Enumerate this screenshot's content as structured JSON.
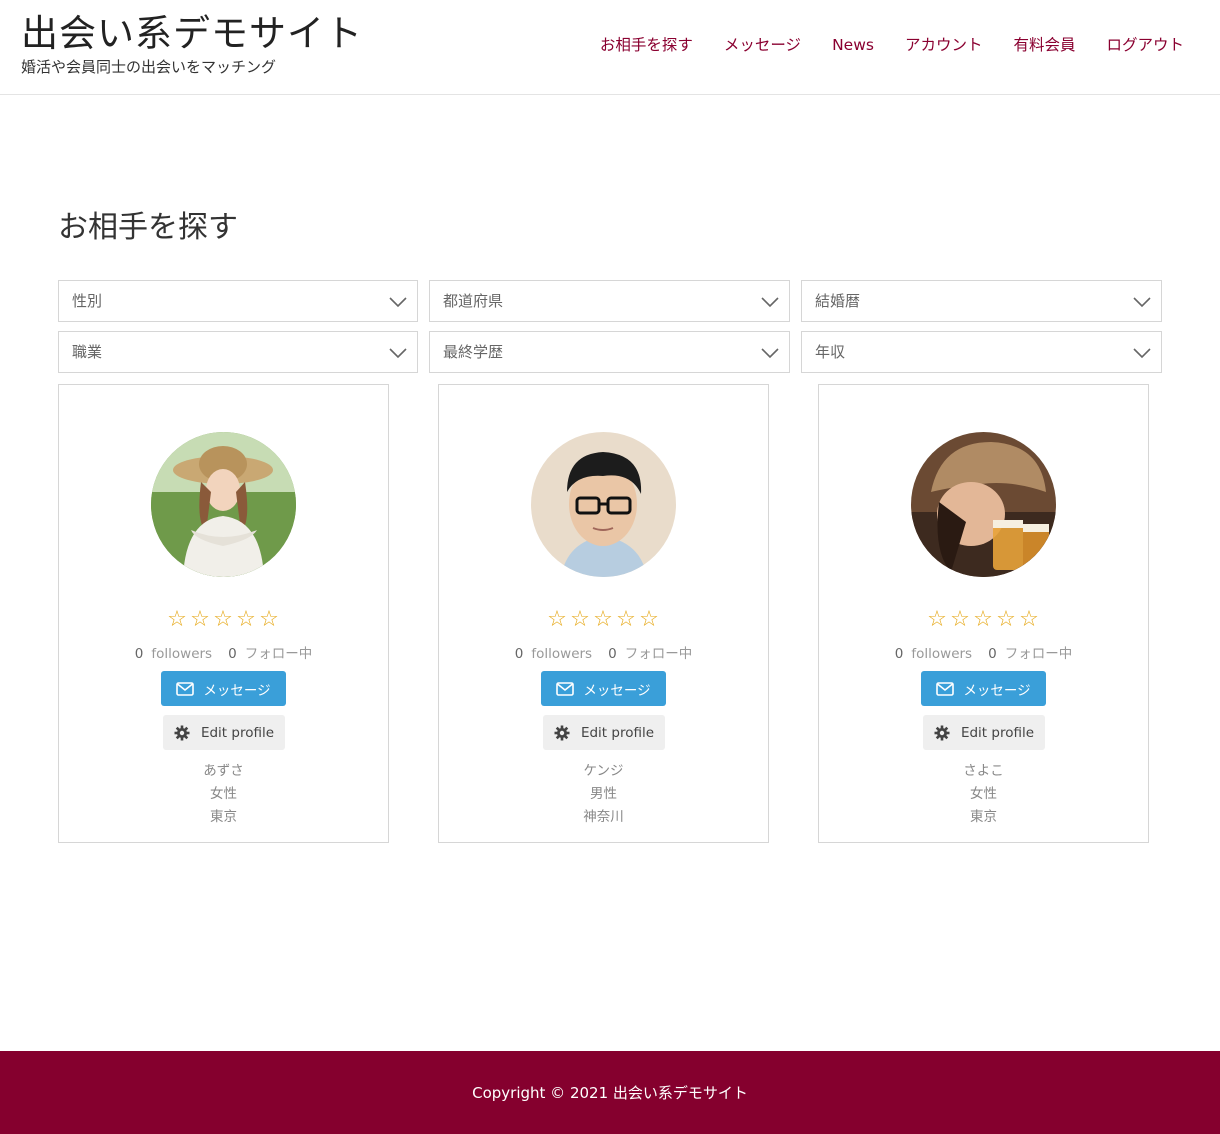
{
  "header": {
    "title": "出会い系デモサイト",
    "tagline": "婚活や会員同士の出会いをマッチング",
    "nav": [
      {
        "label": "お相手を探す"
      },
      {
        "label": "メッセージ"
      },
      {
        "label": "News"
      },
      {
        "label": "アカウント"
      },
      {
        "label": "有料会員"
      },
      {
        "label": "ログアウト"
      }
    ],
    "link_color": "#8a0030"
  },
  "main": {
    "title": "お相手を探す",
    "filters": [
      {
        "label": "性別"
      },
      {
        "label": "都道府県"
      },
      {
        "label": "結婚暦"
      },
      {
        "label": "職業"
      },
      {
        "label": "最終学歴"
      },
      {
        "label": "年収"
      }
    ],
    "profiles": [
      {
        "avatar": "woman-in-sun-hat-photo",
        "rating": "0 of 5",
        "followers_count": "0",
        "followers_label": "followers",
        "following_count": "0",
        "following_label": "フォロー中",
        "message_label": "メッセージ",
        "edit_label": "Edit profile",
        "name": "あずさ",
        "gender": "女性",
        "location": "東京"
      },
      {
        "avatar": "man-with-glasses-photo",
        "rating": "0 of 5",
        "followers_count": "0",
        "followers_label": "followers",
        "following_count": "0",
        "following_label": "フォロー中",
        "message_label": "メッセージ",
        "edit_label": "Edit profile",
        "name": "ケンジ",
        "gender": "男性",
        "location": "神奈川"
      },
      {
        "avatar": "woman-with-cap-and-beer-photo",
        "rating": "0 of 5",
        "followers_count": "0",
        "followers_label": "followers",
        "following_count": "0",
        "following_label": "フォロー中",
        "message_label": "メッセージ",
        "edit_label": "Edit profile",
        "name": "さよこ",
        "gender": "女性",
        "location": "東京"
      }
    ],
    "accent_color": "#3a9fd9",
    "star_color": "#e6a817"
  },
  "footer": {
    "copyright": "Copyright © 2021 出会い系デモサイト",
    "background": "#85002e"
  }
}
